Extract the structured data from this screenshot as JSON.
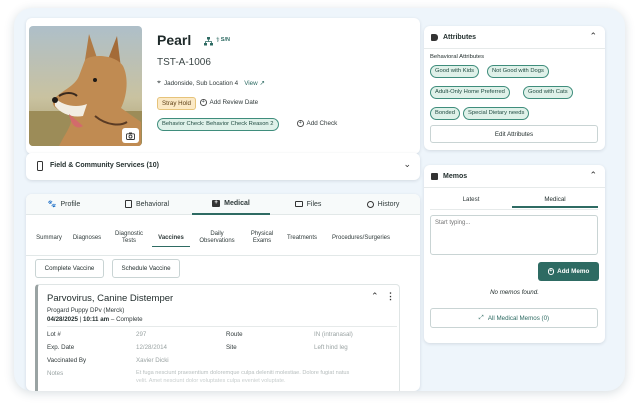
{
  "pet": {
    "name": "Pearl",
    "name_badge": "S/N",
    "id": "TST-A-1006",
    "location": "Jadonside, Sub Location 4",
    "view_link": "View",
    "stray_hold": "Stray Hold",
    "add_review_date": "Add Review Date",
    "behavior_check": "Behavior Check: Behavior Check Reason 2",
    "add_check": "Add Check"
  },
  "field_services": {
    "title": "Field & Community Services (10)"
  },
  "tabs": [
    {
      "label": "Profile",
      "icon": "paw-icon"
    },
    {
      "label": "Behavioral",
      "icon": "clipboard-icon"
    },
    {
      "label": "Medical",
      "icon": "medical-bag-icon",
      "active": true
    },
    {
      "label": "Files",
      "icon": "folder-icon"
    },
    {
      "label": "History",
      "icon": "clock-icon"
    }
  ],
  "subtabs": [
    {
      "label": "Summary"
    },
    {
      "label": "Diagnoses"
    },
    {
      "label": "Diagnostic Tests"
    },
    {
      "label": "Vaccines",
      "active": true
    },
    {
      "label": "Daily Observations"
    },
    {
      "label": "Physical Exams"
    },
    {
      "label": "Treatments"
    },
    {
      "label": "Procedures/Surgeries"
    }
  ],
  "actions": {
    "complete": "Complete Vaccine",
    "schedule": "Schedule Vaccine"
  },
  "vaccine": {
    "title": "Parvovirus, Canine Distemper",
    "product": "Progard Puppy DPv (Merck)",
    "date": "04/28/2025",
    "time": "10:11 am",
    "status": "Complete",
    "status_sep": "–",
    "lot_label": "Lot #",
    "lot_value": "297",
    "route_label": "Route",
    "route_value": "IN (intranasal)",
    "exp_label": "Exp. Date",
    "exp_value": "12/28/2014",
    "site_label": "Site",
    "site_value": "Left hind leg",
    "vaccinated_label": "Vaccinated By",
    "vaccinated_value": "Xavier Dicki",
    "notes_label": "Notes",
    "notes_value_1": "Et fuga nesciunt praesentium doloremque culpa deleniti molestiae. Dolore fugiat natus",
    "notes_value_2": "velit. Amet nesciunt dolor voluptates culpa eveniet voluptate."
  },
  "attributes": {
    "title": "Attributes",
    "section": "Behavioral Attributes",
    "chips": [
      "Good with Kids",
      "Not Good with Dogs",
      "Adult-Only Home Preferred",
      "Good with Cats",
      "Bonded",
      "Special Dietary needs"
    ],
    "edit": "Edit Attributes"
  },
  "memos": {
    "title": "Memos",
    "tabs": [
      "Latest",
      "Medical"
    ],
    "placeholder": "Start typing...",
    "add": "Add Memo",
    "empty": "No memos found.",
    "all": "All Medical Memos (0)"
  },
  "colors": {
    "accent": "#2e6b63",
    "chip_bg": "#dff1e9",
    "chip_border": "#3f8d7c",
    "hold": "#fbe9c6"
  }
}
